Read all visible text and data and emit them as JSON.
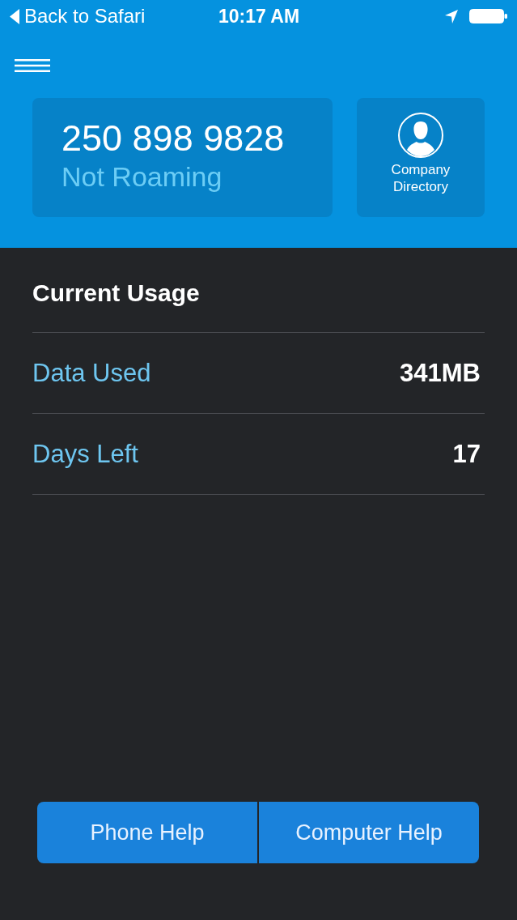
{
  "status_bar": {
    "back_label": "Back to Safari",
    "time": "10:17 AM"
  },
  "header": {
    "phone_number": "250 898 9828",
    "roaming_status": "Not Roaming",
    "directory_button": {
      "label": "Company Directory"
    }
  },
  "usage": {
    "title": "Current Usage",
    "rows": [
      {
        "label": "Data Used",
        "value": "341MB"
      },
      {
        "label": "Days Left",
        "value": "17"
      }
    ]
  },
  "help_buttons": [
    {
      "label": "Phone Help"
    },
    {
      "label": "Computer Help"
    }
  ]
}
